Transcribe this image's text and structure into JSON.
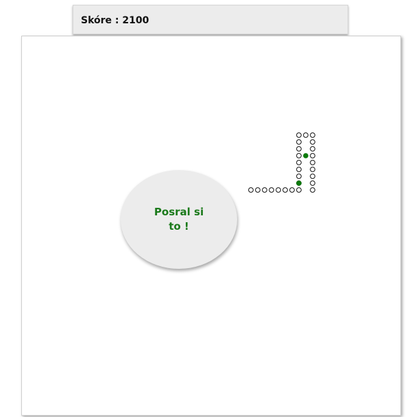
{
  "score": {
    "label": "Skóre : 2100"
  },
  "message": {
    "text": "Posral si to !"
  },
  "colors": {
    "snake_segment_fill": "#ffffff",
    "snake_segment_stroke": "#111111",
    "food": "#0b7a0b",
    "message_text": "#1b7a1b",
    "panel_background": "#ececec"
  },
  "game": {
    "state": "game-over",
    "cell_size": 10,
    "snake": [
      [
        42,
        22
      ],
      [
        42,
        21
      ],
      [
        42,
        20
      ],
      [
        42,
        19
      ],
      [
        42,
        18
      ],
      [
        42,
        17
      ],
      [
        42,
        16
      ],
      [
        42,
        15
      ],
      [
        42,
        14
      ],
      [
        41,
        14
      ],
      [
        40,
        14
      ],
      [
        40,
        15
      ],
      [
        40,
        16
      ],
      [
        40,
        17
      ],
      [
        40,
        18
      ],
      [
        40,
        19
      ],
      [
        40,
        20
      ],
      [
        40,
        21
      ],
      [
        40,
        22
      ],
      [
        39,
        22
      ],
      [
        38,
        22
      ],
      [
        37,
        22
      ],
      [
        36,
        22
      ],
      [
        35,
        22
      ],
      [
        34,
        22
      ],
      [
        33,
        22
      ]
    ],
    "food": [
      [
        41,
        17
      ],
      [
        40,
        21
      ]
    ]
  }
}
